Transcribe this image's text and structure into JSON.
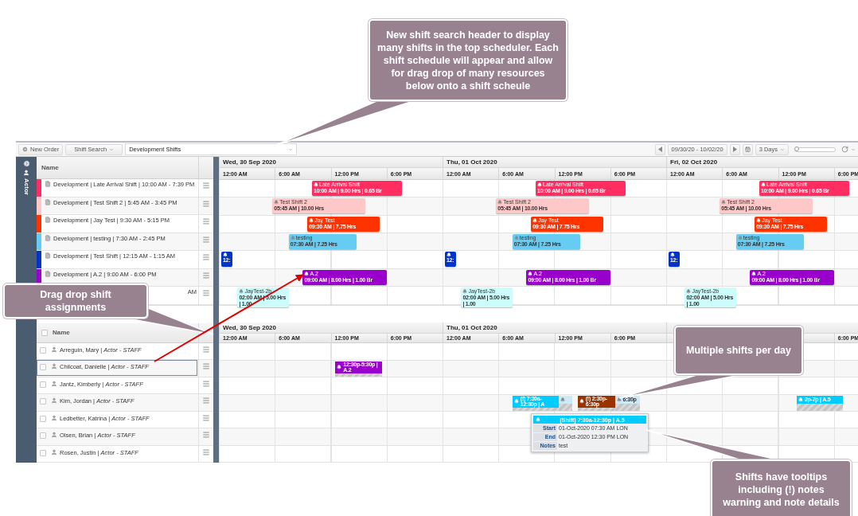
{
  "callouts": [
    {
      "text": "New shift search header to display many shifts in the top scheduler. Each shift schedule will appear and allow for drag drop of many resources below onto a shift scheule"
    },
    {
      "text": "Drag drop shift assignments"
    },
    {
      "text": "Multiple shifts per day"
    },
    {
      "text": "Shifts have tooltips including (!) notes warning and note details"
    }
  ],
  "toolbar": {
    "new_order": "New Order",
    "shift_search": "Shift Search",
    "shift_filter": "Development Shifts",
    "date_range": "09/30/20 - 10/02/20",
    "view": "3 Days",
    "zoom_slider": {
      "level": 0.03
    }
  },
  "sidebar": {
    "label": "Actor"
  },
  "shifts": {
    "column": "Name",
    "days": [
      {
        "date": "Wed, 30 Sep 2020",
        "times": [
          "12:00 AM",
          "6:00 AM",
          "12:00 PM",
          "6:00 PM"
        ]
      },
      {
        "date": "Thu, 01 Oct 2020",
        "times": [
          "12:00 AM",
          "6:00 AM",
          "12:00 PM",
          "6:00 PM"
        ]
      },
      {
        "date": "Fri, 02 Oct 2020",
        "times": [
          "12:00 AM",
          "6:00 AM",
          "12:00 PM",
          "6:00 PM"
        ]
      }
    ],
    "rows": [
      {
        "label": "Development | Late Arrival Shift | 10:00 AM - 7:39 PM",
        "color": "#ff2d60",
        "events": [
          {
            "title": "Late Arrival Shift",
            "detail": "10:00 AM | 9.00 Hrs | 0.65 Br"
          },
          {
            "title": "Late Arrival Shift",
            "detail": "10:00 AM | 9.00 Hrs | 0.65 Br"
          },
          {
            "title": "Late Arrival Shift",
            "detail": "10:00 AM | 9.00 Hrs | 0.65 Br"
          }
        ]
      },
      {
        "label": "Development | Test Shift 2 | 5:45 AM - 3:45 PM",
        "color": "#ffc8c8",
        "events": [
          {
            "title": "Test Shift 2",
            "detail": "05:45 AM | 10.00 Hrs"
          },
          {
            "title": "Test Shift 2",
            "detail": "05:45 AM | 10.00 Hrs"
          },
          {
            "title": "Test Shift 2",
            "detail": "05:45 AM | 10.00 Hrs"
          }
        ]
      },
      {
        "label": "Development | Jay Test | 9:30 AM - 5:15 PM",
        "color": "#ff3300",
        "events": [
          {
            "title": "Jay Test",
            "detail": "09:30 AM | 7.75 Hrs"
          },
          {
            "title": "Jay Test",
            "detail": "09:30 AM | 7.75 Hrs"
          },
          {
            "title": "Jay Test",
            "detail": "09:30 AM | 7.75 Hrs"
          }
        ]
      },
      {
        "label": "Development | testing | 7:30 AM - 2:45 PM",
        "color": "#66ccf2",
        "events": [
          {
            "title": "testing",
            "detail": "07:30 AM | 7.25 Hrs"
          },
          {
            "title": "testing",
            "detail": "07:30 AM | 7.25 Hrs"
          },
          {
            "title": "testing",
            "detail": "07:30 AM | 7.25 Hrs"
          }
        ]
      },
      {
        "label": "Development | Test Shift | 12:15 AM - 1:15 AM",
        "color": "#0033cc",
        "events": [
          {
            "detail": "12:"
          },
          {
            "detail": "12:"
          },
          {
            "detail": "12:"
          }
        ]
      },
      {
        "label": "Development | A.2 | 9:00 AM - 6:00 PM",
        "color": "#9900cc",
        "events": [
          {
            "title": "A.2",
            "detail": "09:00 AM | 8.00 Hrs | 1.00 Br"
          },
          {
            "title": "A.2",
            "detail": "09:00 AM | 8.00 Hrs | 1.00 Br"
          },
          {
            "title": "A.2",
            "detail": "09:00 AM | 8.00 Hrs | 1.00 Br"
          }
        ]
      },
      {
        "label": "AM",
        "partial": true,
        "color": "#ccfcfc",
        "events": [
          {
            "title": "JayTest-2b",
            "detail": "02:00 AM | 5.00 Hrs | 1.00"
          },
          {
            "title": "JayTest-2b",
            "detail": "02:00 AM | 5.00 Hrs | 1.00"
          },
          {
            "title": "JayTest-2b",
            "detail": "02:00 AM | 5.00 Hrs | 1.00"
          }
        ]
      }
    ]
  },
  "resources": {
    "column": "Name",
    "checked": false,
    "days": [
      {
        "date": "Wed, 30 Sep 2020",
        "times": [
          "12:00 AM",
          "6:00 AM",
          "12:00 PM",
          "6:00 PM"
        ]
      },
      {
        "date": "Thu, 01 Oct 2020",
        "times": [
          "12:00 AM",
          "6:00 AM",
          "12:00 PM",
          "6:00 PM"
        ]
      },
      {
        "times": [
          "6:00 PM"
        ]
      }
    ],
    "rows": [
      {
        "name": "Arreguin, Mary | *Actor - STAFF*",
        "checked": false,
        "selected": false
      },
      {
        "name": "Chilcoat, Danielle | *Actor - STAFF*",
        "checked": false,
        "selected": true,
        "events": [
          {
            "label": "12:30p-5:30p | A.2",
            "color": "#9900cc"
          }
        ]
      },
      {
        "name": "Jantz, Kimberly | *Actor - STAFF*",
        "checked": false,
        "selected": false
      },
      {
        "name": "Kim, Jordan | *Actor - STAFF*",
        "checked": false,
        "selected": false,
        "events": [
          {
            "label": "(!) 7:30a-12:30p | A",
            "color": "#00ccff"
          },
          {
            "color": "#cde9f6"
          },
          {
            "label": "(!) 2:30p-6:30p",
            "color": "#993300"
          },
          {
            "label": "6:30p",
            "color": "#cde9f6"
          },
          {
            "label": "2p-7p | A.5",
            "color": "#00ccff"
          }
        ]
      },
      {
        "name": "Ledbetter, Katrina | *Actor - STAFF*",
        "checked": false,
        "selected": false
      },
      {
        "name": "Olsen, Brian | *Actor - STAFF*",
        "checked": false,
        "selected": false
      },
      {
        "name": "Rosen, Justin | *Actor - STAFF*",
        "checked": false,
        "selected": false
      }
    ]
  },
  "tooltip": {
    "title": "[Shift] 7:30a-12:30p | A.5",
    "fields": [
      {
        "label": "Start",
        "value": "01-Oct-2020 07:30 AM LON"
      },
      {
        "label": "End",
        "value": "01-Oct-2020 12:30 PM LON"
      },
      {
        "label": "Notes",
        "value": "test"
      }
    ]
  }
}
